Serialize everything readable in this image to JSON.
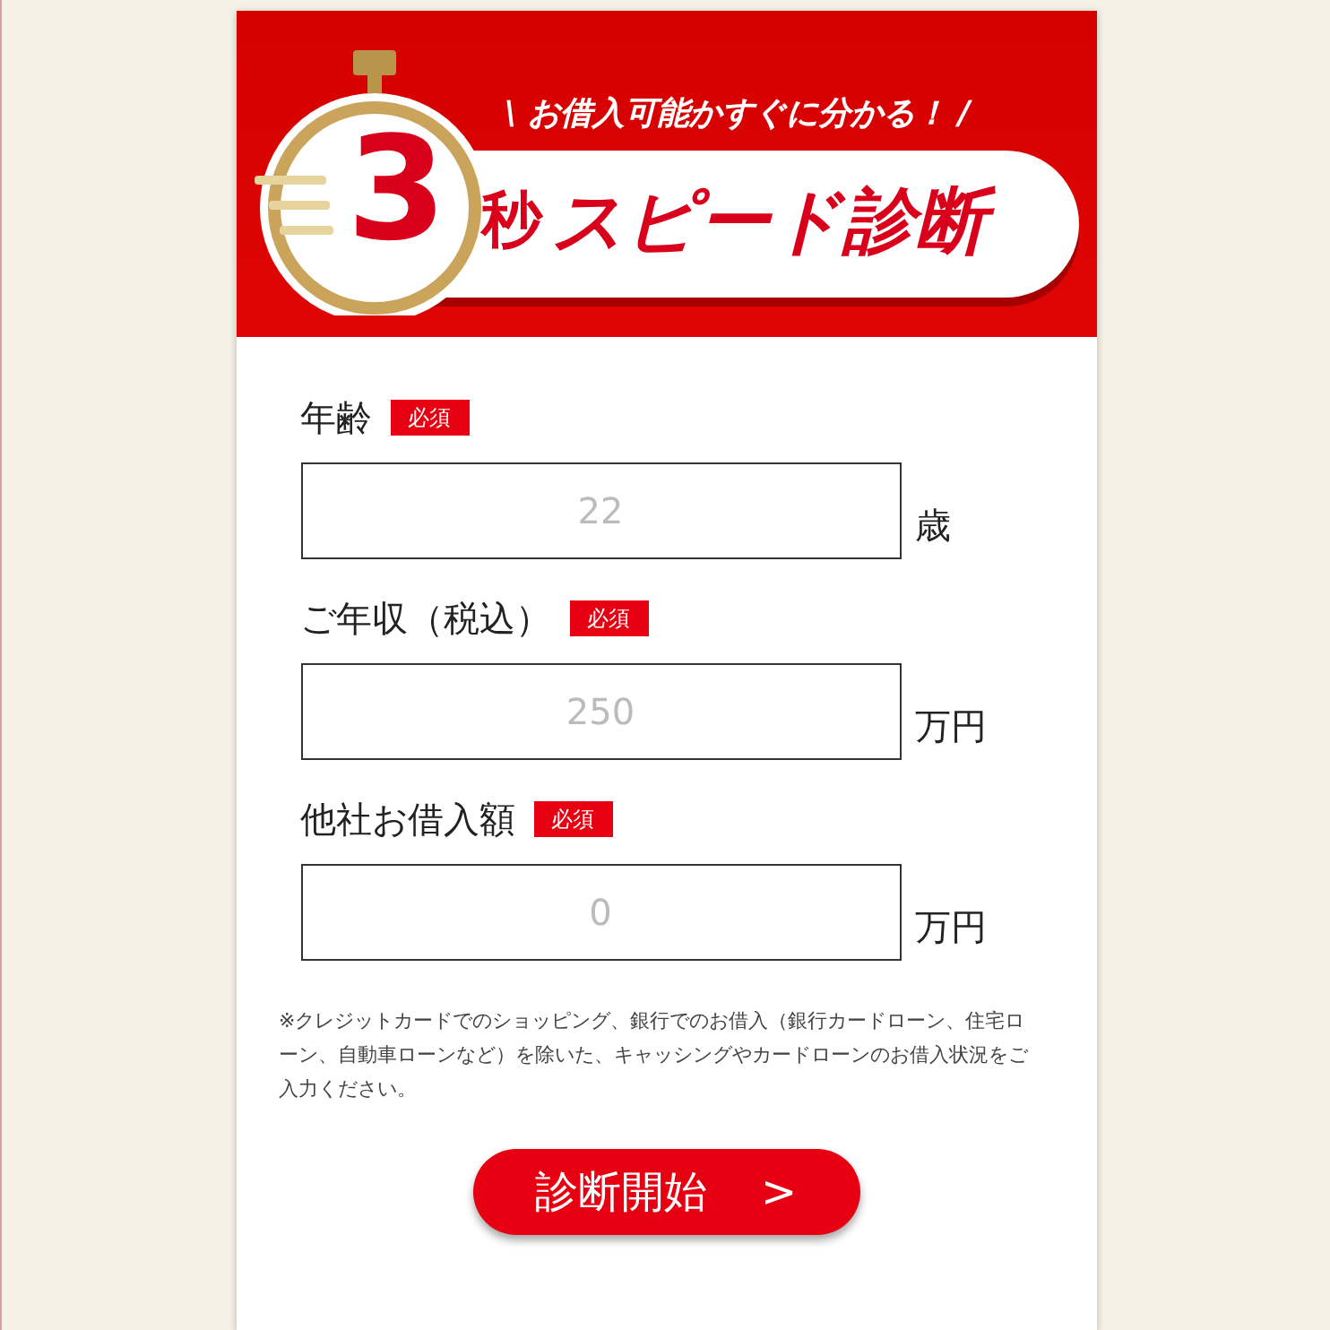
{
  "banner": {
    "tagline": "\\ お借入可能かすぐに分かる！ /",
    "number": "3",
    "unit": "秒",
    "title": "スピード診断"
  },
  "fields": [
    {
      "label": "年齢",
      "badge": "必須",
      "placeholder": "22",
      "unit": "歳"
    },
    {
      "label": "ご年収（税込）",
      "badge": "必須",
      "placeholder": "250",
      "unit": "万円"
    },
    {
      "label": "他社お借入額",
      "badge": "必須",
      "placeholder": "0",
      "unit": "万円"
    }
  ],
  "note": "※クレジットカードでのショッピング、銀行でのお借入（銀行カードローン、住宅ローン、自動車ローンなど）を除いた、キャッシングやカードローンのお借入状況をご入力ください。",
  "submit": {
    "label": "診断開始",
    "arrow": ">"
  }
}
